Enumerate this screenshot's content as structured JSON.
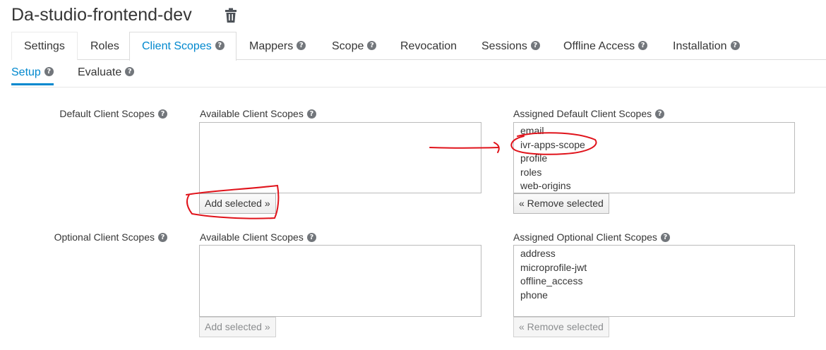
{
  "page": {
    "title": "Da-studio-frontend-dev"
  },
  "tabs": [
    {
      "label": "Settings",
      "help": false
    },
    {
      "label": "Roles",
      "help": false
    },
    {
      "label": "Client Scopes",
      "help": true
    },
    {
      "label": "Mappers",
      "help": true
    },
    {
      "label": "Scope",
      "help": true
    },
    {
      "label": "Revocation",
      "help": false
    },
    {
      "label": "Sessions",
      "help": true
    },
    {
      "label": "Offline Access",
      "help": true
    },
    {
      "label": "Installation",
      "help": true
    }
  ],
  "active_tab": "Client Scopes",
  "subtabs": [
    {
      "label": "Setup"
    },
    {
      "label": "Evaluate"
    }
  ],
  "active_subtab": "Setup",
  "help_glyph": "?",
  "default_section": {
    "label": "Default Client Scopes",
    "available_label": "Available Client Scopes",
    "available_items": [],
    "add_button": "Add selected »",
    "assigned_label": "Assigned Default Client Scopes",
    "assigned_items": [
      "email",
      "ivr-apps-scope",
      "profile",
      "roles",
      "web-origins"
    ],
    "remove_button": "« Remove selected"
  },
  "optional_section": {
    "label": "Optional Client Scopes",
    "available_label": "Available Client Scopes",
    "available_items": [],
    "add_button": "Add selected »",
    "assigned_label": "Assigned Optional Client Scopes",
    "assigned_items": [
      "address",
      "microprofile-jwt",
      "offline_access",
      "phone"
    ],
    "remove_button": "« Remove selected"
  },
  "icons": {
    "delete": "trash-icon",
    "help": "help-circle-icon"
  },
  "colors": {
    "accent": "#0088ce",
    "annotation": "#e0131b",
    "text": "#363636"
  }
}
